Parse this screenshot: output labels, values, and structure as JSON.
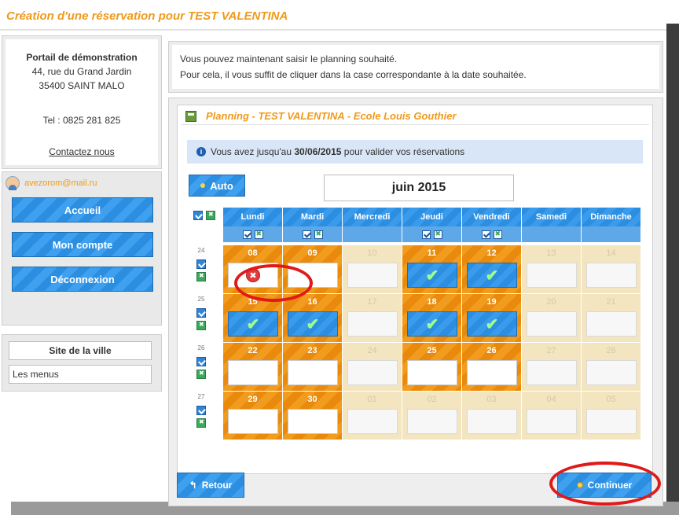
{
  "page": {
    "title": "Création d'une réservation pour TEST VALENTINA"
  },
  "sidebar": {
    "portal_name": "Portail de démonstration",
    "address_line1": "44, rue du Grand Jardin",
    "address_line2": "35400 SAINT MALO",
    "phone": "Tel : 0825 281 825",
    "contact_link": "Contactez nous",
    "user_email": "avezorom@mail.ru",
    "buttons": {
      "home": "Accueil",
      "account": "Mon compte",
      "logout": "Déconnexion"
    },
    "links": {
      "city_site": "Site de la ville",
      "menus": "Les menus"
    }
  },
  "info": {
    "line1": "Vous pouvez maintenant saisir le planning souhaité.",
    "line2": "Pour cela, il vous suffit de cliquer dans la case correspondante à la date souhaitée."
  },
  "planning": {
    "title": "Planning - TEST VALENTINA - Ecole Louis Gouthier",
    "alert_prefix": "Vous avez jusqu'au ",
    "alert_date": "30/06/2015",
    "alert_suffix": " pour valider vos réservations",
    "auto_label": "Auto",
    "month": "juin 2015",
    "days": [
      "Lundi",
      "Mardi",
      "Mercredi",
      "Jeudi",
      "Vendredi",
      "Samedi",
      "Dimanche"
    ],
    "weeks": [
      {
        "num": "24",
        "cells": [
          {
            "day": "08",
            "open": true,
            "state": "cancel"
          },
          {
            "day": "09",
            "open": true,
            "state": "empty"
          },
          {
            "day": "10",
            "open": false,
            "state": "empty"
          },
          {
            "day": "11",
            "open": true,
            "state": "checked"
          },
          {
            "day": "12",
            "open": true,
            "state": "checked"
          },
          {
            "day": "13",
            "open": false,
            "state": "empty"
          },
          {
            "day": "14",
            "open": false,
            "state": "empty"
          }
        ]
      },
      {
        "num": "25",
        "cells": [
          {
            "day": "15",
            "open": true,
            "state": "checked"
          },
          {
            "day": "16",
            "open": true,
            "state": "checked"
          },
          {
            "day": "17",
            "open": false,
            "state": "empty"
          },
          {
            "day": "18",
            "open": true,
            "state": "checked"
          },
          {
            "day": "19",
            "open": true,
            "state": "checked"
          },
          {
            "day": "20",
            "open": false,
            "state": "empty"
          },
          {
            "day": "21",
            "open": false,
            "state": "empty"
          }
        ]
      },
      {
        "num": "26",
        "cells": [
          {
            "day": "22",
            "open": true,
            "state": "empty"
          },
          {
            "day": "23",
            "open": true,
            "state": "empty"
          },
          {
            "day": "24",
            "open": false,
            "state": "empty"
          },
          {
            "day": "25",
            "open": true,
            "state": "empty"
          },
          {
            "day": "26",
            "open": true,
            "state": "empty"
          },
          {
            "day": "27",
            "open": false,
            "state": "empty"
          },
          {
            "day": "28",
            "open": false,
            "state": "empty"
          }
        ]
      },
      {
        "num": "27",
        "cells": [
          {
            "day": "29",
            "open": true,
            "state": "empty"
          },
          {
            "day": "30",
            "open": true,
            "state": "empty"
          },
          {
            "day": "01",
            "open": false,
            "state": "empty"
          },
          {
            "day": "02",
            "open": false,
            "state": "empty"
          },
          {
            "day": "03",
            "open": false,
            "state": "empty"
          },
          {
            "day": "04",
            "open": false,
            "state": "empty"
          },
          {
            "day": "05",
            "open": false,
            "state": "empty"
          }
        ]
      }
    ],
    "back_label": "Retour",
    "continue_label": "Continuer"
  },
  "colors": {
    "accent_orange": "#f09a1a",
    "button_blue": "#2b8ee0",
    "highlight_red": "#e01919"
  }
}
